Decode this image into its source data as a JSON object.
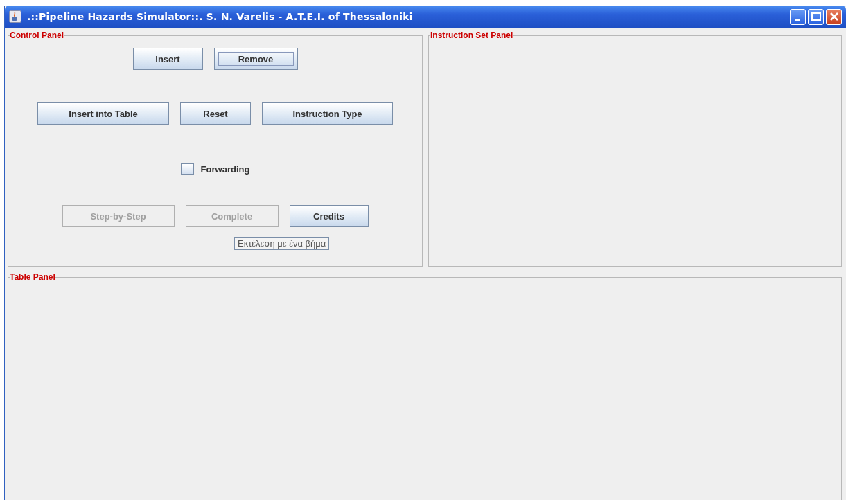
{
  "window": {
    "title": ".::Pipeline Hazards Simulator::. S. N. Varelis - A.T.E.I. of Thessaloniki"
  },
  "control_panel": {
    "title": "Control Panel",
    "button_rows": [
      [
        {
          "label": "Insert",
          "disabled": false,
          "focused": false
        },
        {
          "label": "Remove",
          "disabled": false,
          "focused": true
        }
      ],
      [
        {
          "label": "Insert into Table",
          "disabled": false,
          "focused": false
        },
        {
          "label": "Reset",
          "disabled": false,
          "focused": false
        },
        {
          "label": "Instruction Type",
          "disabled": false,
          "focused": false
        }
      ]
    ],
    "checkbox": {
      "label": "Forwarding",
      "checked": false
    },
    "bottom_buttons": [
      {
        "label": "Step-by-Step",
        "disabled": true,
        "focused": false
      },
      {
        "label": "Complete",
        "disabled": true,
        "focused": false
      },
      {
        "label": "Credits",
        "disabled": false,
        "focused": false
      }
    ],
    "tooltip": "Εκτέλεση με ένα βήμα"
  },
  "instruction_set_panel": {
    "title": "Instruction Set Panel"
  },
  "table_panel": {
    "title": "Table Panel"
  }
}
